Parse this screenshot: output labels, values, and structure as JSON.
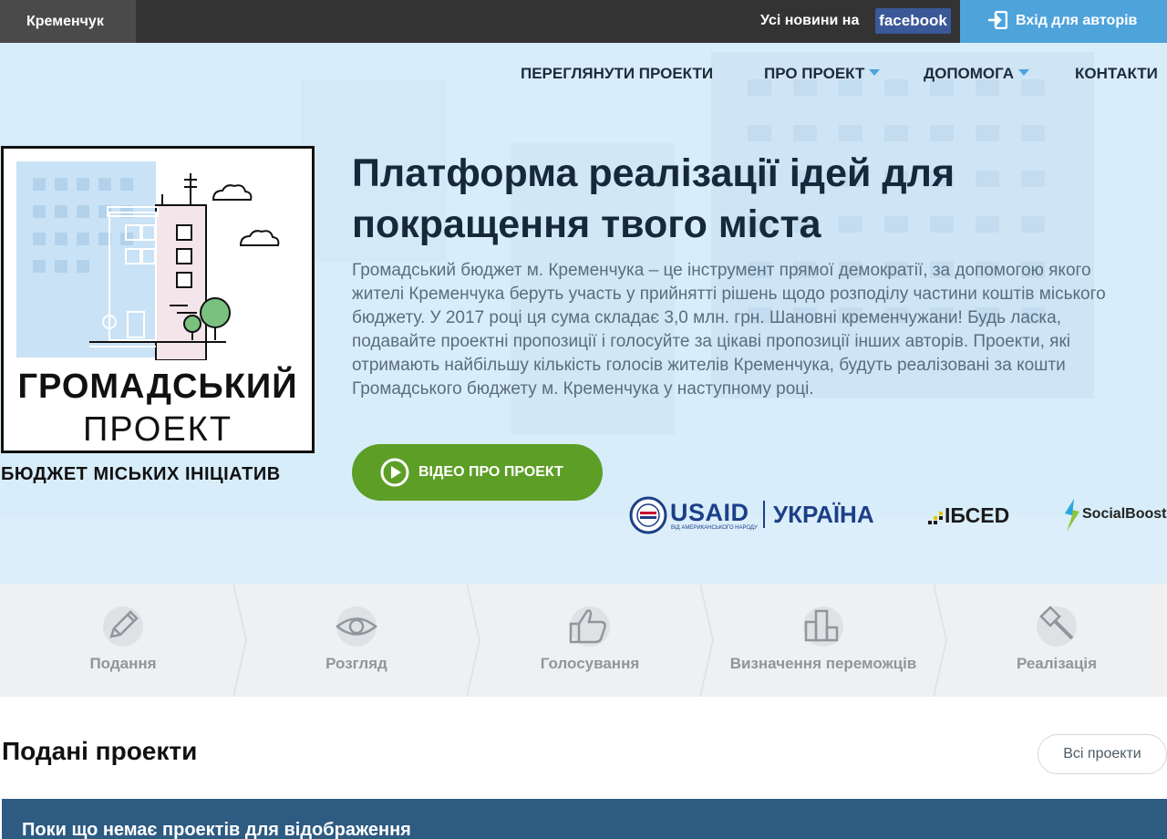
{
  "topbar": {
    "city": "Кременчук",
    "all_news": "Усі новини на",
    "facebook": "facebook",
    "login": "Вхід для авторів"
  },
  "nav": {
    "items": [
      {
        "label": "ПЕРЕГЛЯНУТИ ПРОЕКТИ",
        "dropdown": false
      },
      {
        "label": "ПРО ПРОЕКТ",
        "dropdown": true
      },
      {
        "label": "ДОПОМОГА",
        "dropdown": true
      },
      {
        "label": "КОНТАКТИ",
        "dropdown": false
      }
    ]
  },
  "logo": {
    "title": "ГРОМАДСЬКИЙ",
    "subtitle": "ПРОЕКТ",
    "caption": "БЮДЖЕТ МІСЬКИХ ІНІЦІАТИВ"
  },
  "hero": {
    "title_line1": "Платформа реалізації ідей для",
    "title_line2": "покращення твого міста",
    "text": "Громадський бюджет м. Кременчука – це інструмент прямої демократії, за допомогою якого жителі Кременчука беруть участь у прийнятті рішень щодо розподілу частини коштів міського бюджету. У 2017 році ця сума складає 3,0 млн. грн. Шановні кременчужани! Будь ласка, подавайте проектні пропозиції і голосуйте за цікаві пропозиції інших авторів. Проекти, які отримають найбільшу кількість голосів жителів Кременчука, будуть реалізовані за кошти Громадського бюджету м. Кременчука у наступному році.",
    "video_button": "ВІДЕО ПРО ПРОЕКТ"
  },
  "partners": {
    "usaid": "USAID",
    "usaid_small": "ВІД АМЕРИКАНСЬКОГО НАРОДУ",
    "usaid_country": "УКРАЇНА",
    "ibsed": "ІБСЕD",
    "socialboost": "SocialBoost"
  },
  "stages": [
    {
      "label": "Подання",
      "icon": "pencil-icon"
    },
    {
      "label": "Розгляд",
      "icon": "eye-icon"
    },
    {
      "label": "Голосування",
      "icon": "thumbs-up-icon"
    },
    {
      "label": "Визначення переможців",
      "icon": "bar-chart-icon"
    },
    {
      "label": "Реалізація",
      "icon": "hammer-icon"
    }
  ],
  "projects": {
    "title": "Подані проекти",
    "all_button": "Всі проекти",
    "empty_message": "Поки що немає проектів для відображення"
  },
  "colors": {
    "topbar": "#333333",
    "login": "#4ea3db",
    "facebook": "#3b5998",
    "video_button": "#5d9e27",
    "empty_bar": "#2d5b82"
  }
}
